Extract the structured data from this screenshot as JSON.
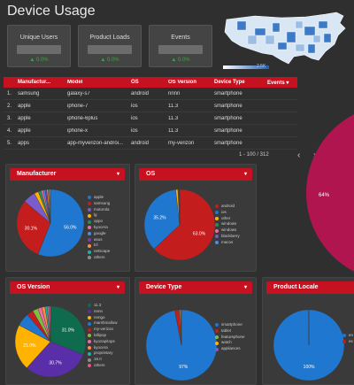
{
  "title": "Device Usage",
  "kpis": [
    {
      "label": "Unique Users",
      "delta": "▲ 0.0%"
    },
    {
      "label": "Product Loads",
      "delta": "▲ 0.0%"
    },
    {
      "label": "Events",
      "delta": "▲ 0.0%"
    }
  ],
  "colors": {
    "accent": "#c61220",
    "positive": "#3aa843",
    "map_blue": "#2e6dbd"
  },
  "map": {
    "legend_max": "2.5K"
  },
  "table": {
    "headers": [
      "",
      "Manufactur...",
      "Model",
      "OS",
      "OS Version",
      "Device Type",
      "Events ▾"
    ],
    "rows": [
      [
        "1.",
        "samsung",
        "galaxy-s7",
        "android",
        "nnnn",
        "smartphone",
        ""
      ],
      [
        "2.",
        "apple",
        "iphone-7",
        "ios",
        "11.3",
        "smartphone",
        ""
      ],
      [
        "3.",
        "apple",
        "iphone-6plus",
        "ios",
        "11.3",
        "smartphone",
        ""
      ],
      [
        "4.",
        "apple",
        "iphone-x",
        "ios",
        "11.3",
        "smartphone",
        ""
      ],
      [
        "5.",
        "apps",
        "app-myverizon-androi...",
        "android",
        "my-verizon",
        "smartphone",
        ""
      ]
    ],
    "pagination": "1 - 100 / 312"
  },
  "big_pie": {
    "label": "64%"
  },
  "panels": {
    "manufacturer": {
      "title": "Manufacturer",
      "legend": [
        "apple",
        "samsung",
        "motorola",
        "lg",
        "oppo",
        "kyocera",
        "google",
        "asus",
        "tcl",
        "netscape",
        "others"
      ]
    },
    "os": {
      "title": "OS",
      "legend": [
        "android",
        "ios",
        "other",
        "windows",
        "windows",
        "blackberry",
        "macos"
      ]
    },
    "os_version": {
      "title": "OS Version",
      "legend": [
        "11.3",
        "nnnn",
        "nnngo",
        "marshmallow",
        "my-verizon",
        "lollipop",
        "kyozapitops",
        "kyocera",
        "proprietary",
        "16.0",
        "others"
      ]
    },
    "device_type": {
      "title": "Device Type",
      "legend": [
        "smartphone",
        "tablet",
        "featurephone",
        "watch",
        "appliances"
      ]
    },
    "product_locale": {
      "title": "Product Locale",
      "legend": [
        "en",
        "es"
      ]
    }
  },
  "chart_data": [
    {
      "type": "pie",
      "title": "Manufacturer",
      "categories": [
        "apple",
        "samsung",
        "motorola",
        "lg",
        "oppo",
        "kyocera",
        "google",
        "asus",
        "tcl",
        "netscape",
        "others"
      ],
      "values": [
        56.0,
        30.1,
        6.0,
        2.0,
        1.4,
        1.0,
        0.9,
        0.8,
        0.7,
        0.6,
        0.5
      ],
      "data_labels": [
        "56.0%",
        "30.1%"
      ]
    },
    {
      "type": "pie",
      "title": "OS",
      "categories": [
        "android",
        "ios",
        "other",
        "windows",
        "windows",
        "blackberry",
        "macos"
      ],
      "values": [
        63.0,
        35.2,
        1.0,
        0.3,
        0.2,
        0.2,
        0.1
      ],
      "data_labels": [
        "63.0%",
        "35.2%"
      ]
    },
    {
      "type": "pie",
      "title": "OS Version",
      "categories": [
        "11.3",
        "nnnn",
        "nnngo",
        "marshmallow",
        "my-verizon",
        "lollipop",
        "kyozapitops",
        "kyocera",
        "proprietary",
        "16.0",
        "others"
      ],
      "values": [
        31.0,
        30.7,
        21.0,
        6.0,
        3.0,
        2.5,
        1.8,
        1.5,
        1.0,
        0.8,
        0.7
      ],
      "data_labels": [
        "31.0%",
        "30.7%",
        "21.0%"
      ]
    },
    {
      "type": "pie",
      "title": "Device Type",
      "categories": [
        "smartphone",
        "tablet",
        "featurephone",
        "watch",
        "appliances"
      ],
      "values": [
        97.0,
        2.0,
        0.5,
        0.3,
        0.2
      ],
      "data_labels": [
        "97%"
      ]
    },
    {
      "type": "pie",
      "title": "Product Locale",
      "categories": [
        "en",
        "es"
      ],
      "values": [
        99.9,
        0.1
      ],
      "data_labels": [
        "100%"
      ]
    }
  ]
}
